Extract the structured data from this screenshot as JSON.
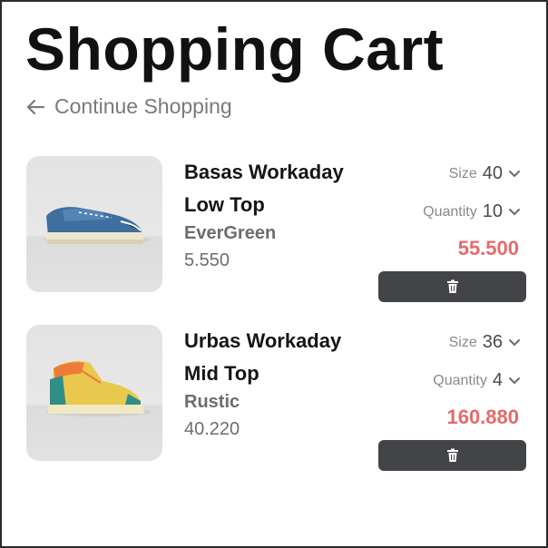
{
  "page": {
    "title": "Shopping Cart",
    "continue_label": "Continue Shopping"
  },
  "labels": {
    "size": "Size",
    "quantity": "Quantity"
  },
  "colors": {
    "price": "#e56a6a",
    "button_bg": "#434448",
    "text_muted": "#7a7a7a"
  },
  "icons": {
    "back": "arrow-left-icon",
    "chevron": "chevron-down-icon",
    "delete": "trash-icon"
  },
  "cart": {
    "items": [
      {
        "name": "Basas Workaday Low Top",
        "brand": "EverGreen",
        "unit_price": "5.550",
        "size": "40",
        "quantity": "10",
        "total": "55.500"
      },
      {
        "name": "Urbas Workaday Mid Top",
        "brand": "Rustic",
        "unit_price": "40.220",
        "size": "36",
        "quantity": "4",
        "total": "160.880"
      }
    ]
  }
}
